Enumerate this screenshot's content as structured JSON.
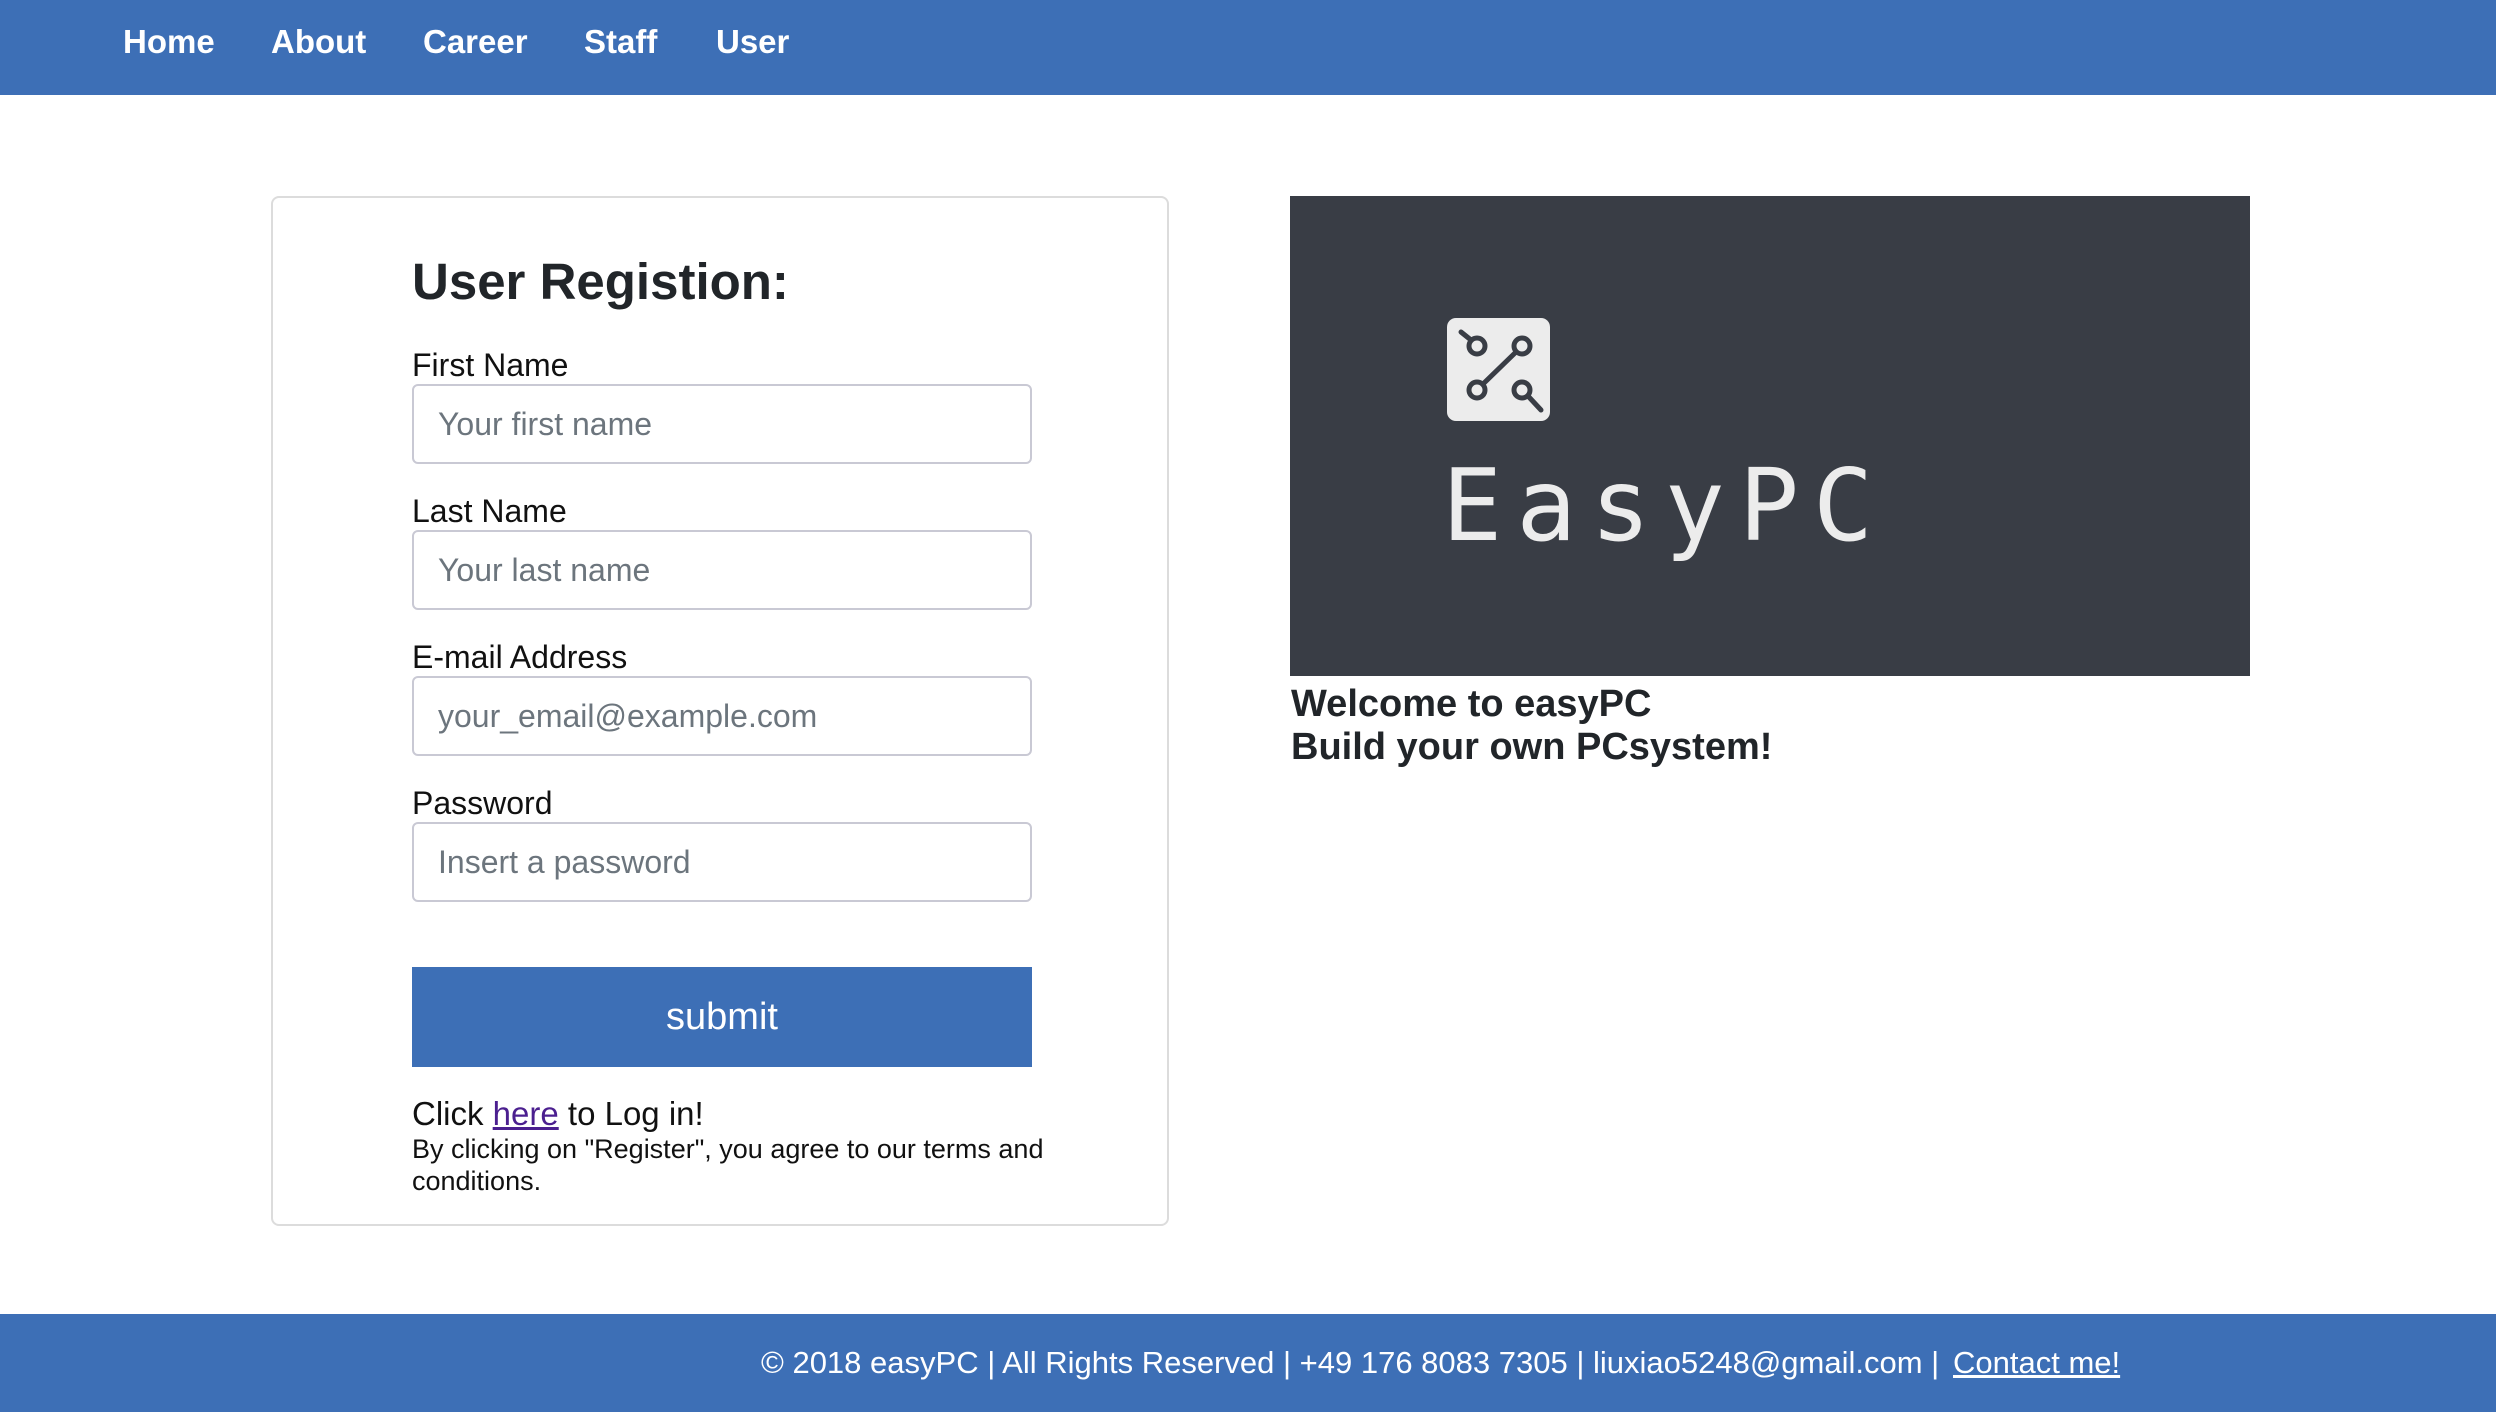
{
  "nav": {
    "items": [
      {
        "label": "Home"
      },
      {
        "label": "About"
      },
      {
        "label": "Career"
      },
      {
        "label": "Staff"
      },
      {
        "label": "User"
      }
    ]
  },
  "form": {
    "title": "User Registion:",
    "first_name": {
      "label": "First Name",
      "placeholder": "Your first name"
    },
    "last_name": {
      "label": "Last Name",
      "placeholder": "Your last name"
    },
    "email": {
      "label": "E-mail Address",
      "placeholder": "your_email@example.com"
    },
    "password": {
      "label": "Password",
      "placeholder": "Insert a password"
    },
    "submit_label": "submit",
    "login_prefix": "Click ",
    "login_link": "here",
    "login_suffix": " to Log in!",
    "terms": "By clicking on \"Register\", you agree to our terms and conditions."
  },
  "banner": {
    "logo_text": "EasyPC",
    "logo_icon": "circuit-icon",
    "background_color": "#393d45"
  },
  "welcome": {
    "line1": "Welcome to easyPC",
    "line2": "Build your own PCsystem!"
  },
  "footer": {
    "text": "© 2018 easyPC | All Rights Reserved | +49 176 8083 7305 | liuxiao5248@gmail.com |",
    "contact_link": "Contact me!"
  },
  "colors": {
    "accent": "#3d6fb6",
    "link_visited": "#4b1f8f"
  }
}
